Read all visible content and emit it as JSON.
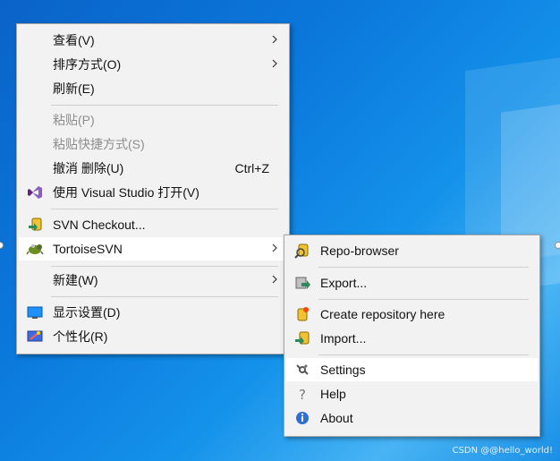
{
  "context_menu": {
    "items": [
      {
        "label": "查看(V)",
        "icon": "",
        "submenu": true,
        "disabled": false
      },
      {
        "label": "排序方式(O)",
        "icon": "",
        "submenu": true,
        "disabled": false
      },
      {
        "label": "刷新(E)",
        "icon": "",
        "submenu": false,
        "disabled": false
      },
      {
        "label": "粘贴(P)",
        "icon": "",
        "submenu": false,
        "disabled": true
      },
      {
        "label": "粘贴快捷方式(S)",
        "icon": "",
        "submenu": false,
        "disabled": true
      },
      {
        "label": "撤消 删除(U)",
        "shortcut": "Ctrl+Z",
        "icon": "",
        "submenu": false,
        "disabled": false
      },
      {
        "label": "使用 Visual Studio 打开(V)",
        "icon": "visual-studio-icon",
        "submenu": false,
        "disabled": false
      },
      {
        "label": "SVN Checkout...",
        "icon": "svn-checkout-icon",
        "submenu": false,
        "disabled": false
      },
      {
        "label": "TortoiseSVN",
        "icon": "tortoisesvn-icon",
        "submenu": true,
        "disabled": false,
        "selected": true
      },
      {
        "label": "新建(W)",
        "icon": "",
        "submenu": true,
        "disabled": false
      },
      {
        "label": "显示设置(D)",
        "icon": "display-settings-icon",
        "submenu": false,
        "disabled": false
      },
      {
        "label": "个性化(R)",
        "icon": "personalize-icon",
        "submenu": false,
        "disabled": false
      }
    ]
  },
  "tortoisesvn_submenu": {
    "items": [
      {
        "label": "Repo-browser",
        "icon": "repo-browser-icon"
      },
      {
        "label": "Export...",
        "icon": "export-icon"
      },
      {
        "label": "Create repository here",
        "icon": "create-repository-icon"
      },
      {
        "label": "Import...",
        "icon": "import-icon"
      },
      {
        "label": "Settings",
        "icon": "settings-icon",
        "selected": true
      },
      {
        "label": "Help",
        "icon": "help-icon"
      },
      {
        "label": "About",
        "icon": "about-icon"
      }
    ]
  },
  "watermark": "CSDN @@hello_world!",
  "colors": {
    "desktop_blue": "#0b78dc",
    "menu_bg": "#f2f2f2",
    "highlight_bg": "#ffffff",
    "disabled_text": "#8d8d8d"
  }
}
